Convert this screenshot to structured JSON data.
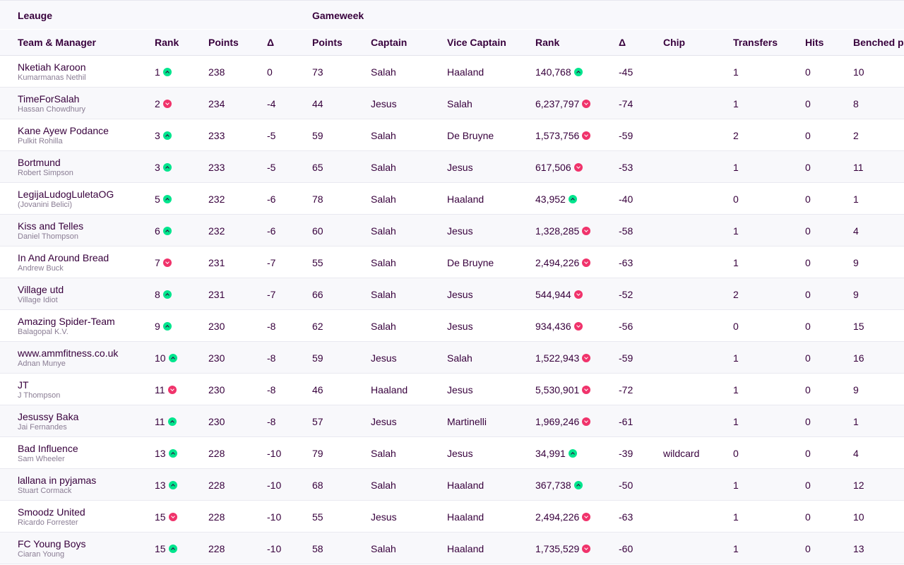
{
  "header": {
    "group_league": "Leauge",
    "group_gameweek": "Gameweek",
    "cols": {
      "team": "Team & Manager",
      "rank": "Rank",
      "points": "Points",
      "delta": "Δ",
      "gw_points": "Points",
      "captain": "Captain",
      "vice": "Vice Captain",
      "gw_rank": "Rank",
      "gw_delta": "Δ",
      "chip": "Chip",
      "transfers": "Transfers",
      "hits": "Hits",
      "benched": "Benched p"
    }
  },
  "rows": [
    {
      "team": "Nketiah Karoon",
      "manager": "Kumarmanas Nethil",
      "rank": "1",
      "rank_dir": "up",
      "points": "238",
      "delta": "0",
      "gw_points": "73",
      "captain": "Salah",
      "vice": "Haaland",
      "gw_rank": "140,768",
      "gw_rank_dir": "up",
      "gw_delta": "-45",
      "chip": "",
      "transfers": "1",
      "hits": "0",
      "benched": "10"
    },
    {
      "team": "TimeForSalah",
      "manager": "Hassan Chowdhury",
      "rank": "2",
      "rank_dir": "down",
      "points": "234",
      "delta": "-4",
      "gw_points": "44",
      "captain": "Jesus",
      "vice": "Salah",
      "gw_rank": "6,237,797",
      "gw_rank_dir": "down",
      "gw_delta": "-74",
      "chip": "",
      "transfers": "1",
      "hits": "0",
      "benched": "8"
    },
    {
      "team": "Kane Ayew Podance",
      "manager": "Pulkit Rohilla",
      "rank": "3",
      "rank_dir": "up",
      "points": "233",
      "delta": "-5",
      "gw_points": "59",
      "captain": "Salah",
      "vice": "De Bruyne",
      "gw_rank": "1,573,756",
      "gw_rank_dir": "down",
      "gw_delta": "-59",
      "chip": "",
      "transfers": "2",
      "hits": "0",
      "benched": "2"
    },
    {
      "team": "Bortmund",
      "manager": "Robert Simpson",
      "rank": "3",
      "rank_dir": "up",
      "points": "233",
      "delta": "-5",
      "gw_points": "65",
      "captain": "Salah",
      "vice": "Jesus",
      "gw_rank": "617,506",
      "gw_rank_dir": "down",
      "gw_delta": "-53",
      "chip": "",
      "transfers": "1",
      "hits": "0",
      "benched": "11"
    },
    {
      "team": "LegijaLudogLuletaOG",
      "manager": "(Jovanini Belici)",
      "rank": "5",
      "rank_dir": "up",
      "points": "232",
      "delta": "-6",
      "gw_points": "78",
      "captain": "Salah",
      "vice": "Haaland",
      "gw_rank": "43,952",
      "gw_rank_dir": "up",
      "gw_delta": "-40",
      "chip": "",
      "transfers": "0",
      "hits": "0",
      "benched": "1"
    },
    {
      "team": "Kiss and Telles",
      "manager": "Daniel Thompson",
      "rank": "6",
      "rank_dir": "up",
      "points": "232",
      "delta": "-6",
      "gw_points": "60",
      "captain": "Salah",
      "vice": "Jesus",
      "gw_rank": "1,328,285",
      "gw_rank_dir": "down",
      "gw_delta": "-58",
      "chip": "",
      "transfers": "1",
      "hits": "0",
      "benched": "4"
    },
    {
      "team": "In And Around Bread",
      "manager": "Andrew Buck",
      "rank": "7",
      "rank_dir": "down",
      "points": "231",
      "delta": "-7",
      "gw_points": "55",
      "captain": "Salah",
      "vice": "De Bruyne",
      "gw_rank": "2,494,226",
      "gw_rank_dir": "down",
      "gw_delta": "-63",
      "chip": "",
      "transfers": "1",
      "hits": "0",
      "benched": "9"
    },
    {
      "team": "Village utd",
      "manager": "Village Idiot",
      "rank": "8",
      "rank_dir": "up",
      "points": "231",
      "delta": "-7",
      "gw_points": "66",
      "captain": "Salah",
      "vice": "Jesus",
      "gw_rank": "544,944",
      "gw_rank_dir": "down",
      "gw_delta": "-52",
      "chip": "",
      "transfers": "2",
      "hits": "0",
      "benched": "9"
    },
    {
      "team": "Amazing Spider-Team",
      "manager": "Balagopal K.V.",
      "rank": "9",
      "rank_dir": "up",
      "points": "230",
      "delta": "-8",
      "gw_points": "62",
      "captain": "Salah",
      "vice": "Jesus",
      "gw_rank": "934,436",
      "gw_rank_dir": "down",
      "gw_delta": "-56",
      "chip": "",
      "transfers": "0",
      "hits": "0",
      "benched": "15"
    },
    {
      "team": "www.ammfitness.co.uk",
      "manager": "Adnan Munye",
      "rank": "10",
      "rank_dir": "up",
      "points": "230",
      "delta": "-8",
      "gw_points": "59",
      "captain": "Jesus",
      "vice": "Salah",
      "gw_rank": "1,522,943",
      "gw_rank_dir": "down",
      "gw_delta": "-59",
      "chip": "",
      "transfers": "1",
      "hits": "0",
      "benched": "16"
    },
    {
      "team": "JT",
      "manager": "J Thompson",
      "rank": "11",
      "rank_dir": "down",
      "points": "230",
      "delta": "-8",
      "gw_points": "46",
      "captain": "Haaland",
      "vice": "Jesus",
      "gw_rank": "5,530,901",
      "gw_rank_dir": "down",
      "gw_delta": "-72",
      "chip": "",
      "transfers": "1",
      "hits": "0",
      "benched": "9"
    },
    {
      "team": "Jesussy Baka",
      "manager": "Jai Fernandes",
      "rank": "11",
      "rank_dir": "up",
      "points": "230",
      "delta": "-8",
      "gw_points": "57",
      "captain": "Jesus",
      "vice": "Martinelli",
      "gw_rank": "1,969,246",
      "gw_rank_dir": "down",
      "gw_delta": "-61",
      "chip": "",
      "transfers": "1",
      "hits": "0",
      "benched": "1"
    },
    {
      "team": "Bad Influence",
      "manager": "Sam Wheeler",
      "rank": "13",
      "rank_dir": "up",
      "points": "228",
      "delta": "-10",
      "gw_points": "79",
      "captain": "Salah",
      "vice": "Jesus",
      "gw_rank": "34,991",
      "gw_rank_dir": "up",
      "gw_delta": "-39",
      "chip": "wildcard",
      "transfers": "0",
      "hits": "0",
      "benched": "4"
    },
    {
      "team": "lallana in pyjamas",
      "manager": "Stuart Cormack",
      "rank": "13",
      "rank_dir": "up",
      "points": "228",
      "delta": "-10",
      "gw_points": "68",
      "captain": "Salah",
      "vice": "Haaland",
      "gw_rank": "367,738",
      "gw_rank_dir": "up",
      "gw_delta": "-50",
      "chip": "",
      "transfers": "1",
      "hits": "0",
      "benched": "12"
    },
    {
      "team": "Smoodz United",
      "manager": "Ricardo Forrester",
      "rank": "15",
      "rank_dir": "down",
      "points": "228",
      "delta": "-10",
      "gw_points": "55",
      "captain": "Jesus",
      "vice": "Haaland",
      "gw_rank": "2,494,226",
      "gw_rank_dir": "down",
      "gw_delta": "-63",
      "chip": "",
      "transfers": "1",
      "hits": "0",
      "benched": "10"
    },
    {
      "team": "FC Young Boys",
      "manager": "Ciaran Young",
      "rank": "15",
      "rank_dir": "up",
      "points": "228",
      "delta": "-10",
      "gw_points": "58",
      "captain": "Salah",
      "vice": "Haaland",
      "gw_rank": "1,735,529",
      "gw_rank_dir": "down",
      "gw_delta": "-60",
      "chip": "",
      "transfers": "1",
      "hits": "0",
      "benched": "13"
    }
  ]
}
